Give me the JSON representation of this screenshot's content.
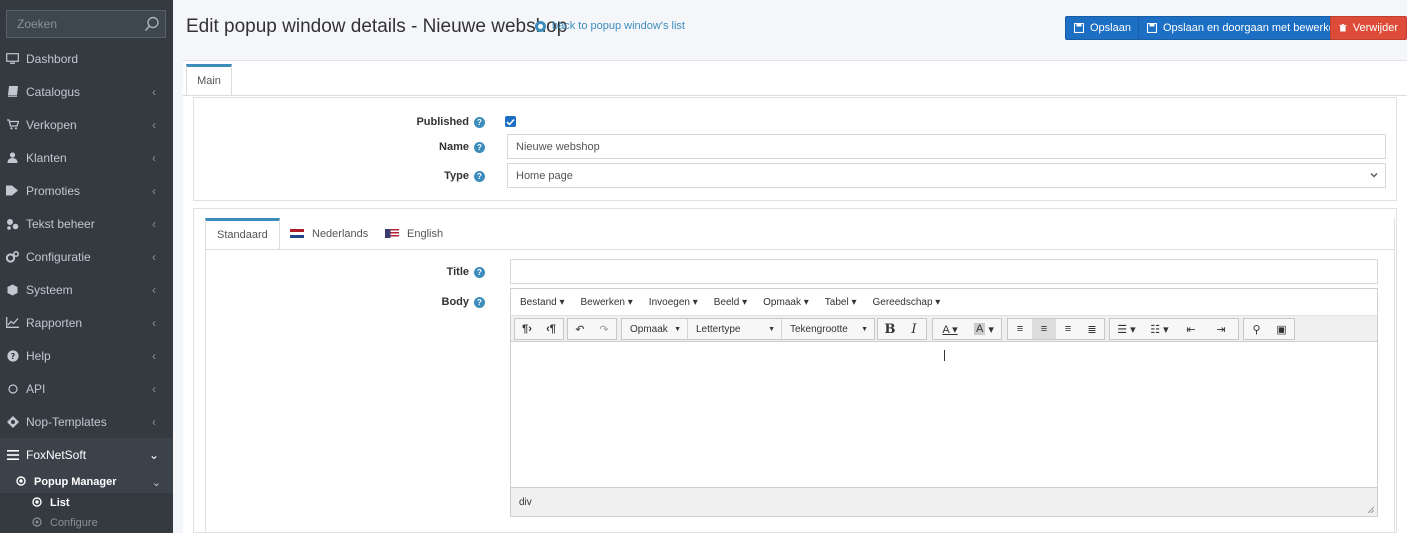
{
  "sidebar": {
    "search_placeholder": "Zoeken",
    "items": [
      {
        "label": "Dashbord",
        "icon": "desktop-icon"
      },
      {
        "label": "Catalogus",
        "icon": "book-icon"
      },
      {
        "label": "Verkopen",
        "icon": "cart-icon"
      },
      {
        "label": "Klanten",
        "icon": "user-icon"
      },
      {
        "label": "Promoties",
        "icon": "tag-icon"
      },
      {
        "label": "Tekst beheer",
        "icon": "sitemap-icon"
      },
      {
        "label": "Configuratie",
        "icon": "gears-icon"
      },
      {
        "label": "Systeem",
        "icon": "cube-icon"
      },
      {
        "label": "Rapporten",
        "icon": "chart-icon"
      },
      {
        "label": "Help",
        "icon": "question-icon"
      },
      {
        "label": "API",
        "icon": "circle-icon"
      },
      {
        "label": "Nop-Templates",
        "icon": "puzzle-icon"
      },
      {
        "label": "FoxNetSoft",
        "icon": "bars-icon"
      }
    ],
    "popup_manager": "Popup Manager",
    "list": "List",
    "configure": "Configure"
  },
  "header": {
    "title": "Edit popup window details - Nieuwe webshop",
    "back_link": "back to popup window's list",
    "save": "Opslaan",
    "save_continue": "Opslaan en doorgaan met bewerken",
    "delete": "Verwijder"
  },
  "main_tab": "Main",
  "form": {
    "published_label": "Published",
    "published": true,
    "name_label": "Name",
    "name_value": "Nieuwe webshop",
    "type_label": "Type",
    "type_value": "Home page"
  },
  "lang_tabs": [
    "Standaard",
    "Nederlands",
    "English"
  ],
  "content": {
    "title_label": "Title",
    "title_value": "",
    "body_label": "Body"
  },
  "editor": {
    "menus": [
      "Bestand",
      "Bewerken",
      "Invoegen",
      "Beeld",
      "Opmaak",
      "Tabel",
      "Gereedschap"
    ],
    "format_drop": "Opmaak",
    "font_drop": "Lettertype",
    "size_drop": "Tekengrootte",
    "status_path": "div"
  },
  "colors": {
    "sidebar_bg": "#343a40",
    "primary": "#1d6fc4",
    "danger": "#dd4b39",
    "link": "#3c8dbc"
  }
}
